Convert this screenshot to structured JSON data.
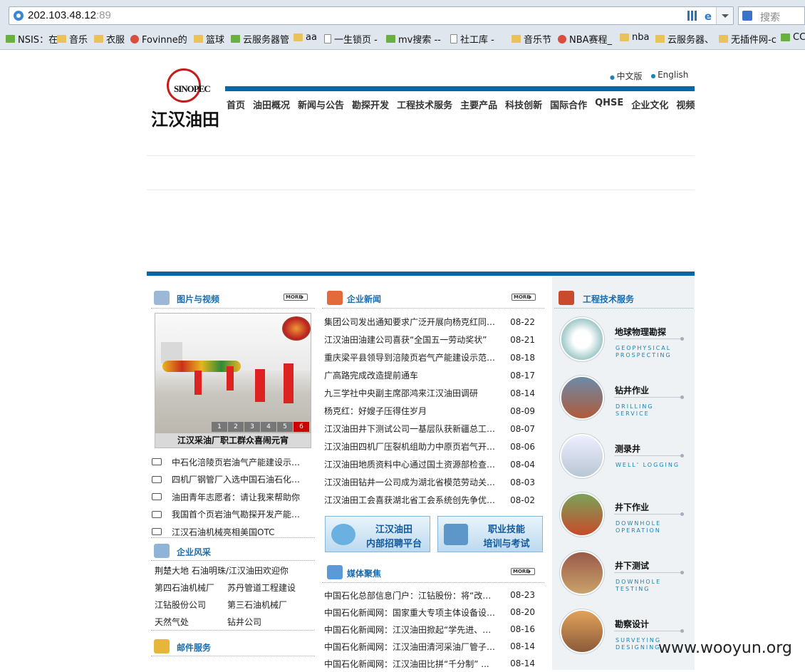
{
  "browser": {
    "url_host": "202.103.48.12",
    "url_port": ":89",
    "search_placeholder": "搜索",
    "bookmarks": [
      "NSIS：在",
      "音乐",
      "衣服",
      "Fovinne的",
      "篮球",
      "云服务器管",
      "aa",
      "一生锁页 -",
      "mv搜索 --",
      "社工库 -",
      "音乐节",
      "NBA赛程_",
      "nba",
      "云服务器、",
      "无插件网-c",
      "CC"
    ]
  },
  "site": {
    "logo_text": "SINOPEC",
    "logo_name": "江汉油田",
    "lang": [
      "中文版",
      "English"
    ],
    "nav": [
      "首页",
      "油田概况",
      "新闻与公告",
      "勘探开发",
      "工程技术服务",
      "主要产品",
      "科技创新",
      "国际合作",
      "QHSE",
      "企业文化",
      "视频"
    ]
  },
  "photo_section": {
    "title": "图片与视频",
    "more": "MORE",
    "caption": "江汉采油厂职工群众喜闹元宵",
    "pager": [
      "1",
      "2",
      "3",
      "4",
      "5",
      "6"
    ],
    "active_page": "6",
    "items": [
      "中石化涪陵页岩油气产能建设示范...",
      "四机厂钢管厂入选中国石油石化装...",
      "油田青年志愿者：请让我来帮助你",
      "我国首个页岩油气勘探开发产能建...",
      "江汉石油机械亮相美国OTC"
    ]
  },
  "style_section": {
    "title": "企业风采",
    "rows": [
      [
        "荆楚大地 石油明珠/江汉油田欢迎你",
        ""
      ],
      [
        "第四石油机械厂",
        "苏丹管道工程建设"
      ],
      [
        "江钻股份公司",
        "第三石油机械厂"
      ],
      [
        "天然气处",
        "钻井公司"
      ]
    ]
  },
  "mail_section": {
    "title": "邮件服务"
  },
  "news_section": {
    "title": "企业新闻",
    "more": "MORE",
    "items": [
      {
        "t": "集团公司发出通知要求广泛开展向杨克红同志...",
        "d": "08-22"
      },
      {
        "t": "江汉油田油建公司喜获“全国五一劳动奖状”",
        "d": "08-21"
      },
      {
        "t": "重庆梁平县领导到涪陵页岩气产能建设示范区...",
        "d": "08-18"
      },
      {
        "t": "广高路完成改造提前通车",
        "d": "08-17"
      },
      {
        "t": "九三学社中央副主席邵鸿来江汉油田调研",
        "d": "08-14"
      },
      {
        "t": "杨克红：好嫂子压得住岁月",
        "d": "08-09"
      },
      {
        "t": "江汉油田井下测试公司一基层队获新疆总工会...",
        "d": "08-07"
      },
      {
        "t": "江汉油田四机厂压裂机组助力中原页岩气开发...",
        "d": "08-06"
      },
      {
        "t": "江汉油田地质资料中心通过国土资源部检查组...",
        "d": "08-04"
      },
      {
        "t": "江汉油田钻井一公司成为湖北省模范劳动关系...",
        "d": "08-03"
      },
      {
        "t": "江汉油田工会喜获湖北省工会系统创先争优红...",
        "d": "08-02"
      }
    ]
  },
  "banners": [
    {
      "l1": "江汉油田",
      "l2": "内部招聘平台"
    },
    {
      "l1": "职业技能",
      "l2": "培训与考试"
    }
  ],
  "media_section": {
    "title": "媒体聚焦",
    "more": "MORE",
    "items": [
      {
        "t": "中国石化总部信息门户：江钻股份：将“改善...",
        "d": "08-23"
      },
      {
        "t": "中国石化新闻网：国家重大专项主体设备设计...",
        "d": "08-20"
      },
      {
        "t": "中国石化新闻网：江汉油田掀起“学先进、促...",
        "d": "08-16"
      },
      {
        "t": "中国石化新闻网：江汉油田清河采油厂管子站...",
        "d": "08-14"
      },
      {
        "t": "中国石化新闻网：江汉油田比拼“千分制” ...",
        "d": "08-14"
      }
    ]
  },
  "service_section": {
    "title": "工程技术服务",
    "items": [
      {
        "cn": "地球物理勘探",
        "en1": "GEOPHYSICAL",
        "en2": "PROSPECTING"
      },
      {
        "cn": "钻井作业",
        "en1": "DRILLING",
        "en2": "SERVICE"
      },
      {
        "cn": "测录井",
        "en1": "WELL' LOGGING",
        "en2": ""
      },
      {
        "cn": "井下作业",
        "en1": "DOWNHOLE",
        "en2": "OPERATION"
      },
      {
        "cn": "井下测试",
        "en1": "DOWNHOLE",
        "en2": "TESTING"
      },
      {
        "cn": "勘察设计",
        "en1": "SURVEYING",
        "en2": "DESIGNING"
      }
    ]
  },
  "watermark": "www.wooyun.org"
}
